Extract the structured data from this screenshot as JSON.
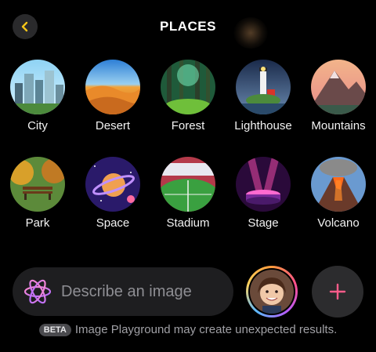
{
  "header": {
    "title": "PLACES"
  },
  "places": [
    {
      "label": "City"
    },
    {
      "label": "Desert"
    },
    {
      "label": "Forest"
    },
    {
      "label": "Lighthouse"
    },
    {
      "label": "Mountains"
    },
    {
      "label": "Park"
    },
    {
      "label": "Space"
    },
    {
      "label": "Stadium"
    },
    {
      "label": "Stage"
    },
    {
      "label": "Volcano"
    }
  ],
  "prompt": {
    "placeholder": "Describe an image",
    "value": ""
  },
  "footer": {
    "badge": "BETA",
    "text": "Image Playground may create unexpected results."
  },
  "colors": {
    "accent": "#f5c518",
    "background": "#000000",
    "add_icon": "#ff5c8a"
  }
}
